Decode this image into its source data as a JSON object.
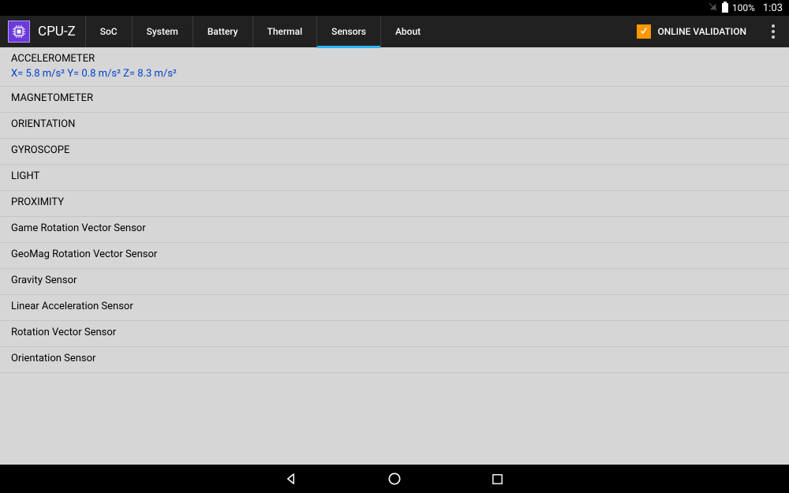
{
  "status": {
    "battery_pct": "100%",
    "time": "1:03"
  },
  "app": {
    "title": "CPU-Z"
  },
  "tabs": [
    {
      "label": "SoC"
    },
    {
      "label": "System"
    },
    {
      "label": "Battery"
    },
    {
      "label": "Thermal"
    },
    {
      "label": "Sensors"
    },
    {
      "label": "About"
    }
  ],
  "validation_label": "ONLINE VALIDATION",
  "sensors": [
    {
      "name": "ACCELEROMETER",
      "values": "X= 5.8 m/s²   Y= 0.8 m/s²   Z= 8.3 m/s²"
    },
    {
      "name": "MAGNETOMETER"
    },
    {
      "name": "ORIENTATION"
    },
    {
      "name": "GYROSCOPE"
    },
    {
      "name": "LIGHT"
    },
    {
      "name": "PROXIMITY"
    },
    {
      "name": "Game Rotation Vector Sensor"
    },
    {
      "name": "GeoMag Rotation Vector Sensor"
    },
    {
      "name": "Gravity Sensor"
    },
    {
      "name": "Linear Acceleration Sensor"
    },
    {
      "name": "Rotation Vector Sensor"
    },
    {
      "name": "Orientation Sensor"
    }
  ]
}
